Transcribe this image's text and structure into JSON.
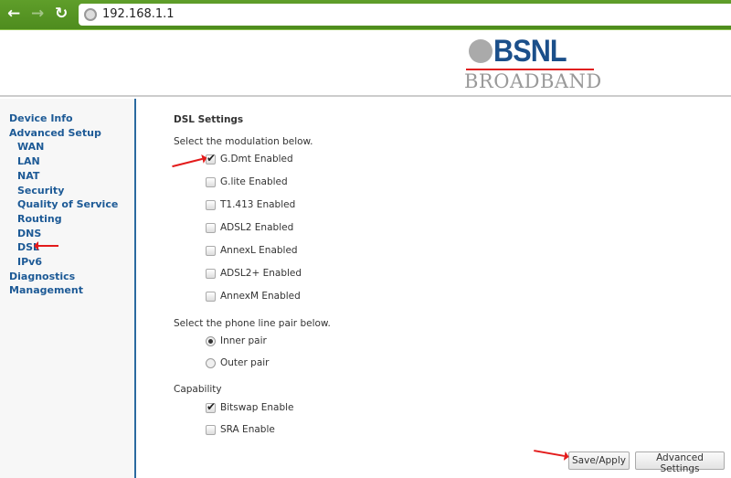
{
  "browser": {
    "url": "192.168.1.1",
    "back_icon": "arrow-left",
    "forward_icon": "arrow-right",
    "reload_icon": "reload"
  },
  "logo": {
    "brand": "BSNL",
    "sub": "BROADBAND"
  },
  "sidebar": {
    "items": [
      {
        "label": "Device Info",
        "level": 0
      },
      {
        "label": "Advanced Setup",
        "level": 0
      },
      {
        "label": "WAN",
        "level": 1
      },
      {
        "label": "LAN",
        "level": 1
      },
      {
        "label": "NAT",
        "level": 1
      },
      {
        "label": "Security",
        "level": 1
      },
      {
        "label": "Quality of Service",
        "level": 1
      },
      {
        "label": "Routing",
        "level": 1
      },
      {
        "label": "DNS",
        "level": 1
      },
      {
        "label": "DSL",
        "level": 1
      },
      {
        "label": "IPv6",
        "level": 1
      },
      {
        "label": "Diagnostics",
        "level": 0
      },
      {
        "label": "Management",
        "level": 0
      }
    ]
  },
  "main": {
    "title": "DSL Settings",
    "modulation_prompt": "Select the modulation below.",
    "modulations": [
      {
        "label": "G.Dmt Enabled",
        "checked": true
      },
      {
        "label": "G.lite Enabled",
        "checked": false
      },
      {
        "label": "T1.413 Enabled",
        "checked": false
      },
      {
        "label": "ADSL2 Enabled",
        "checked": false
      },
      {
        "label": "AnnexL Enabled",
        "checked": false
      },
      {
        "label": "ADSL2+ Enabled",
        "checked": false
      },
      {
        "label": "AnnexM Enabled",
        "checked": false
      }
    ],
    "pair_prompt": "Select the phone line pair below.",
    "pairs": [
      {
        "label": "Inner pair",
        "selected": true
      },
      {
        "label": "Outer pair",
        "selected": false
      }
    ],
    "capability_label": "Capability",
    "capabilities": [
      {
        "label": "Bitswap Enable",
        "checked": true
      },
      {
        "label": "SRA Enable",
        "checked": false
      }
    ],
    "save_label": "Save/Apply",
    "advanced_label": "Advanced Settings"
  },
  "colors": {
    "accent": "#1d5a96",
    "annotation": "#e31b1b",
    "topbar": "#5f9e2a"
  }
}
